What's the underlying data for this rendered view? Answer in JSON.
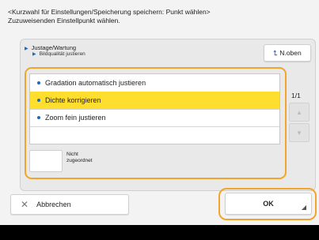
{
  "instruction": {
    "line1": "<Kurzwahl für Einstellungen/Speicherung speichern: Punkt wählen>",
    "line2": "Zuzuweisenden Einstellpunkt wählen."
  },
  "breadcrumb": {
    "level1": "Justage/Wartung",
    "level2": "Bildqualität justieren"
  },
  "up_button": {
    "arrow": "⮤",
    "label": "N.oben"
  },
  "list": {
    "items": [
      {
        "label": "Gradation automatisch justieren",
        "selected": false
      },
      {
        "label": "Dichte korrigieren",
        "selected": true
      },
      {
        "label": "Zoom fein justieren",
        "selected": false
      }
    ]
  },
  "pager": {
    "text": "1/1"
  },
  "unassigned": {
    "line1": "Nicht",
    "line2": "zugeordnet"
  },
  "footer": {
    "cancel_label": "Abbrechen",
    "ok_label": "OK"
  },
  "colors": {
    "accent_blue": "#1f66c4",
    "highlight_yellow": "#ffde2e",
    "focus_orange": "#f2a52c"
  }
}
